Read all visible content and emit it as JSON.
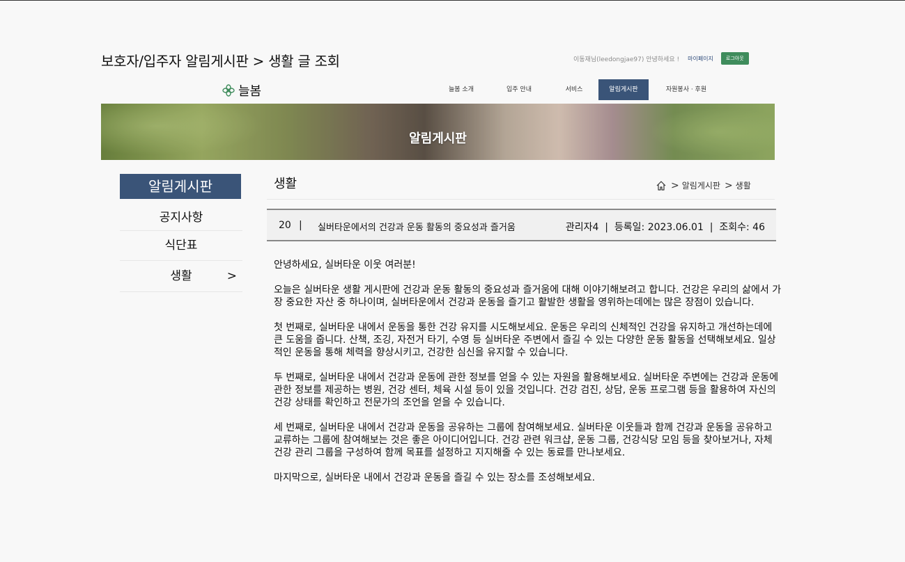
{
  "header": {
    "page_title": "보호자/입주자 알림게시판 > 생활 글 조회",
    "greeting": "이동재님(leedongjae97) 안녕하세요 !",
    "mypage_label": "마이페이지",
    "logout_label": "로그아웃"
  },
  "logo": {
    "text": "늘봄"
  },
  "nav": {
    "items": [
      {
        "label": "늘봄 소개"
      },
      {
        "label": "입주 안내"
      },
      {
        "label": "서비스"
      },
      {
        "label": "알림게시판",
        "active": true
      },
      {
        "label": "자원봉사 · 후원"
      }
    ]
  },
  "banner": {
    "title": "알림게시판"
  },
  "sidebar": {
    "header": "알림게시판",
    "items": [
      {
        "label": "공지사항"
      },
      {
        "label": "식단표"
      },
      {
        "label": "생활",
        "active": true,
        "arrow": ">"
      }
    ]
  },
  "content": {
    "section_title": "생활",
    "breadcrumb": {
      "sep1": ">",
      "item1": "알림게시판",
      "sep2": ">",
      "item2": "생활"
    },
    "post": {
      "number": "20",
      "divider": "|",
      "title": "실버타운에서의 건강과 운동 활동의 중요성과 즐거움",
      "meta": "관리자4  |  등록일: 2023.06.01  |  조회수: 46"
    },
    "body": [
      "안녕하세요, 실버타운 이웃 여러분!",
      "오늘은 실버타운 생활 게시판에 건강과 운동 활동의 중요성과 즐거움에 대해 이야기해보려고 합니다. 건강은 우리의 삶에서 가장 중요한 자산 중 하나이며, 실버타운에서 건강과 운동을 즐기고 활발한 생활을 영위하는데에는 많은 장점이 있습니다.",
      "첫 번째로, 실버타운 내에서 운동을 통한 건강 유지를 시도해보세요. 운동은 우리의 신체적인 건강을 유지하고 개선하는데에 큰 도움을 줍니다. 산책, 조깅, 자전거 타기, 수영 등 실버타운 주변에서 즐길 수 있는 다양한 운동 활동을 선택해보세요. 일상적인 운동을 통해 체력을 향상시키고, 건강한 심신을 유지할 수 있습니다.",
      "두 번째로, 실버타운 내에서 건강과 운동에 관한 정보를 얻을 수 있는 자원을 활용해보세요. 실버타운 주변에는 건강과 운동에 관한 정보를 제공하는 병원, 건강 센터, 체육 시설 등이 있을 것입니다. 건강 검진, 상담, 운동 프로그램 등을 활용하여 자신의 건강 상태를 확인하고 전문가의 조언을 얻을 수 있습니다.",
      "세 번째로, 실버타운 내에서 건강과 운동을 공유하는 그룹에 참여해보세요. 실버타운 이웃들과 함께 건강과 운동을 공유하고 교류하는 그룹에 참여해보는 것은 좋은 아이디어입니다. 건강 관련 워크샵, 운동 그룹, 건강식당 모임 등을 찾아보거나, 자체 건강 관리 그룹을 구성하여 함께 목표를 설정하고 지지해줄 수 있는 동료를 만나보세요.",
      "마지막으로, 실버타운 내에서 건강과 운동을 즐길 수 있는 장소를 조성해보세요."
    ]
  },
  "colors": {
    "primary": "#3a5478",
    "logout": "#3f8c5c",
    "background": "#f8f8f8"
  }
}
